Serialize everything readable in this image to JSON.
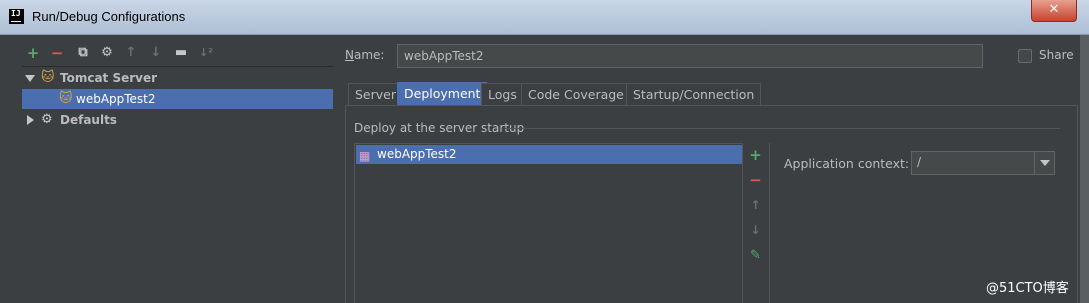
{
  "window": {
    "title": "Run/Debug Configurations",
    "close": "✕",
    "app_icon": "IJ"
  },
  "toolbar": {
    "add": "+",
    "remove": "−",
    "copy": "⧉",
    "settings": "⚙",
    "up": "↑",
    "down": "↓",
    "folder": "▬",
    "sort": "↓²"
  },
  "tree": {
    "items": [
      {
        "label": "Tomcat Server",
        "icon": "tomcat-icon"
      },
      {
        "label": "webAppTest2",
        "icon": "tomcat-icon"
      },
      {
        "label": "Defaults",
        "icon": "wrench-icon"
      }
    ]
  },
  "name_field": {
    "label_underlined": "N",
    "label_rest": "ame:",
    "value": "webAppTest2"
  },
  "share": {
    "label": "Share",
    "checked": false
  },
  "tabs": [
    {
      "label": "Server",
      "active": false
    },
    {
      "label": "Deployment",
      "active": true
    },
    {
      "label": "Logs",
      "active": false
    },
    {
      "label": "Code Coverage",
      "active": false
    },
    {
      "label": "Startup/Connection",
      "active": false
    }
  ],
  "deployment": {
    "caption": "Deploy at the server startup",
    "items": [
      {
        "label": "webAppTest2",
        "icon": "artifact-icon"
      }
    ],
    "buttons": {
      "add": "+",
      "remove": "−",
      "up": "↑",
      "down": "↓",
      "edit": "✎"
    },
    "context_label": "Application context:",
    "context_value": "/"
  },
  "watermark": "@51CTO博客",
  "colors": {
    "accent": "#4b6eaf",
    "background": "#3c3f41",
    "add_green": "#59a869",
    "remove_red": "#e05555"
  }
}
